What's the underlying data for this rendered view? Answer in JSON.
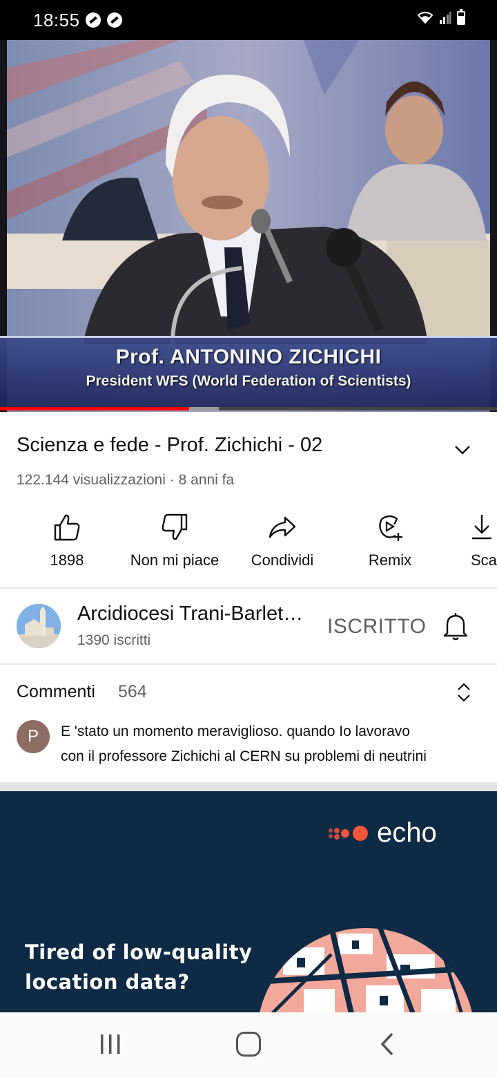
{
  "status_bar": {
    "time": "18:55",
    "notification_icons": [
      "app-notification-icon",
      "app-notification-icon"
    ],
    "right_icons": [
      "wifi-icon",
      "signal-icon",
      "battery-icon"
    ]
  },
  "video": {
    "overlay_name": "Prof. ANTONINO ZICHICHI",
    "overlay_role": "President WFS (World Federation of Scientists)",
    "progress": 0.38,
    "buffered": 0.44,
    "title": "Scienza e fede - Prof. Zichichi - 02",
    "meta": "122.144 visualizzazioni · 8 anni fa"
  },
  "actions": [
    {
      "icon": "thumbs-up-icon",
      "label": "1898"
    },
    {
      "icon": "thumbs-down-icon",
      "label": "Non mi piace"
    },
    {
      "icon": "share-icon",
      "label": "Condividi"
    },
    {
      "icon": "remix-icon",
      "label": "Remix"
    },
    {
      "icon": "download-icon",
      "label": "Sca"
    }
  ],
  "channel": {
    "name": "Arcidiocesi Trani-Barletta-Bisceglie",
    "subscribers": "1390 iscritti",
    "subscribe_state": "ISCRITTO"
  },
  "comments": {
    "title": "Commenti",
    "count": "564",
    "top_comment": {
      "avatar_letter": "P",
      "line1": "E 'stato un momento meraviglioso. quando Io  lavoravo",
      "line2": "con il professore Zichichi al CERN su problemi di neutrini"
    }
  },
  "ad": {
    "brand": "echo",
    "headline_line1": "Tired of low-quality",
    "headline_line2": "location data?"
  },
  "colors": {
    "progress": "#ff0000",
    "ad_background": "#0e2a45",
    "ad_accent": "#f4563a"
  }
}
